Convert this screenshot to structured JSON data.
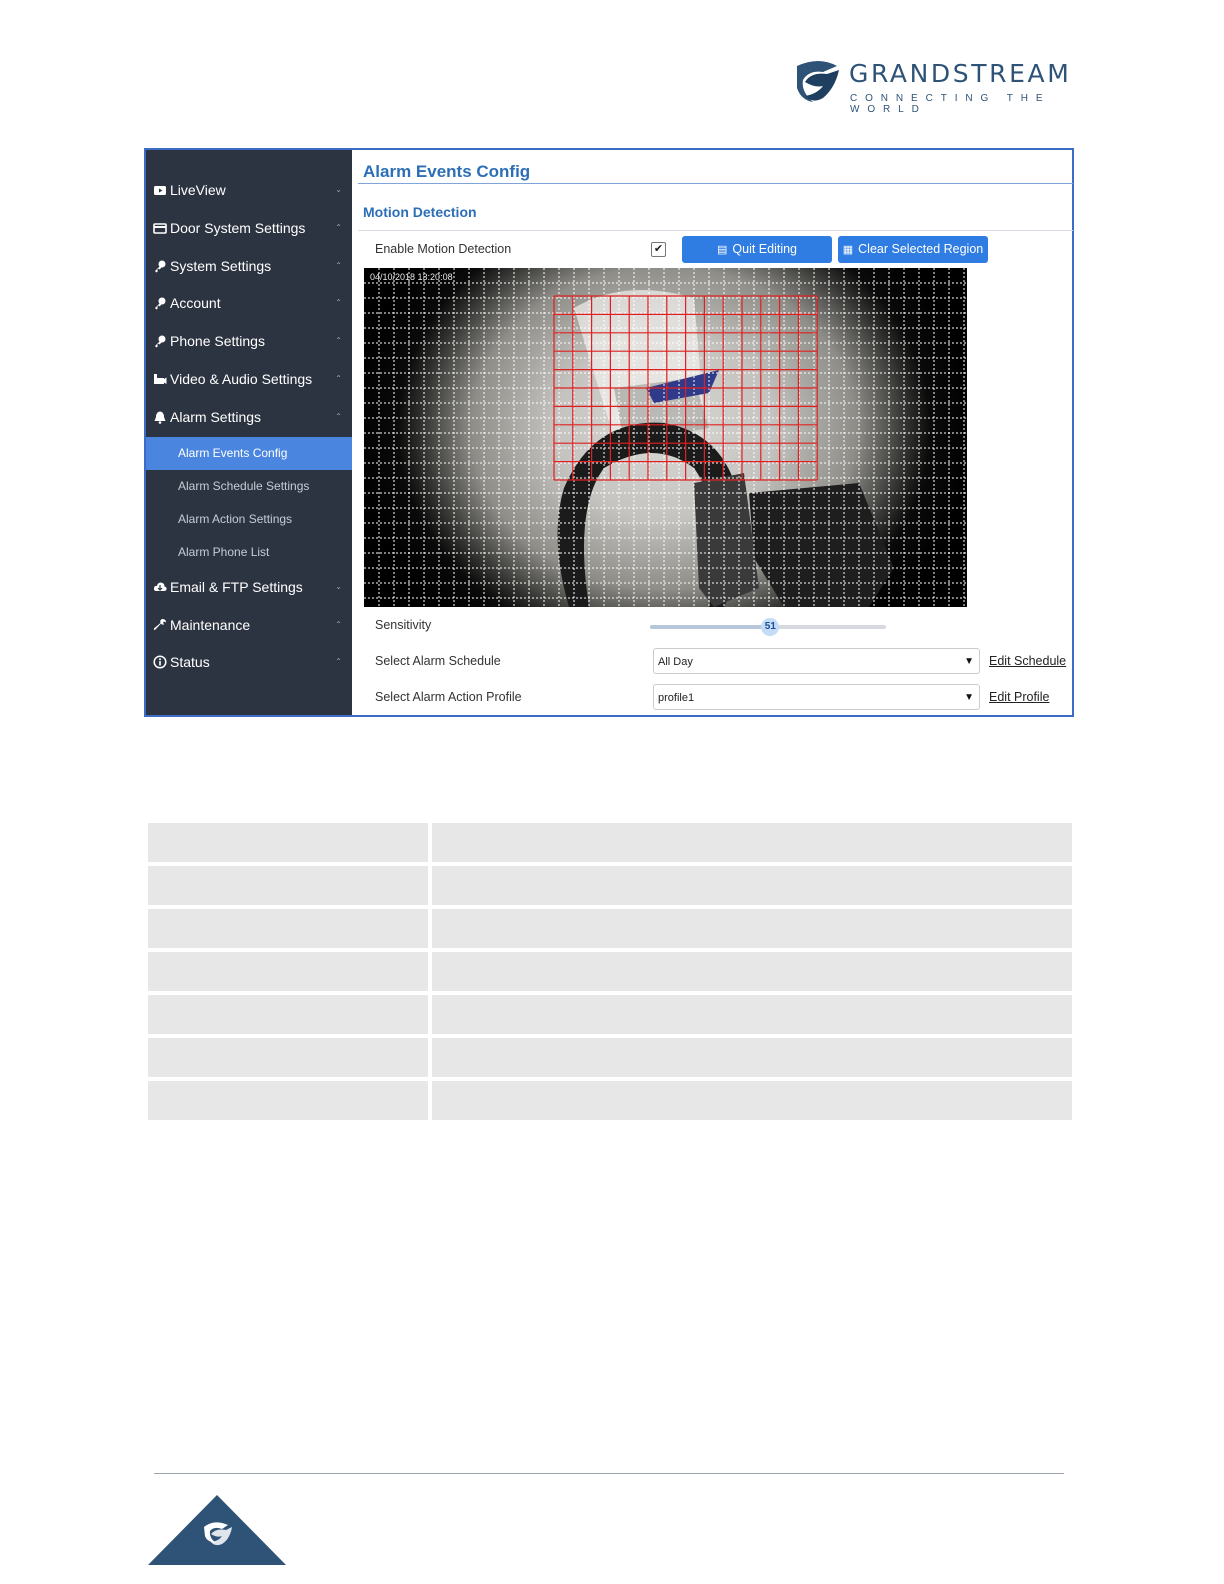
{
  "brand": {
    "name": "GRANDSTREAM",
    "tagline": "CONNECTING THE WORLD",
    "colors": {
      "navy": "#2e5377",
      "accent": "#2f7ce3",
      "sidebar": "#2d3441"
    }
  },
  "sidebar": {
    "items": [
      {
        "label": "LiveView",
        "icon": "video-icon",
        "chevron": "⌄"
      },
      {
        "label": "Door System Settings",
        "icon": "card-icon",
        "chevron": "⌃"
      },
      {
        "label": "System Settings",
        "icon": "key-icon",
        "chevron": "⌃"
      },
      {
        "label": "Account",
        "icon": "key-icon",
        "chevron": "⌃"
      },
      {
        "label": "Phone Settings",
        "icon": "key-icon",
        "chevron": "⌃"
      },
      {
        "label": "Video & Audio Settings",
        "icon": "camera-icon",
        "chevron": "⌃"
      },
      {
        "label": "Alarm Settings",
        "icon": "bell-icon",
        "chevron": "⌃"
      }
    ],
    "subitems": [
      {
        "label": "Alarm Events Config",
        "active": true
      },
      {
        "label": "Alarm Schedule Settings",
        "active": false
      },
      {
        "label": "Alarm Action Settings",
        "active": false
      },
      {
        "label": "Alarm Phone List",
        "active": false
      }
    ],
    "items_after": [
      {
        "label": "Email & FTP Settings",
        "icon": "cloud-icon",
        "chevron": "⌄"
      },
      {
        "label": "Maintenance",
        "icon": "wrench-icon",
        "chevron": "⌃"
      },
      {
        "label": "Status",
        "icon": "info-icon",
        "chevron": "⌃"
      }
    ]
  },
  "main": {
    "title": "Alarm Events Config",
    "section": "Motion Detection",
    "enable_label": "Enable Motion Detection",
    "enable_checked": true,
    "checkmark": "✔",
    "quit_button": "Quit Editing",
    "clear_button": "Clear Selected Region",
    "video_timestamp": "04/10/2018 13:20:08",
    "sensitivity_label": "Sensitivity",
    "sensitivity_value": 51,
    "sensitivity_max": 100,
    "schedule_label": "Select Alarm Schedule",
    "schedule_value": "All Day",
    "schedule_link": "Edit Schedule",
    "profile_label": "Select Alarm Action Profile",
    "profile_value": "profile1",
    "profile_link": "Edit Profile",
    "dropdown_arrow": "▼"
  },
  "table": {
    "row_count": 7
  }
}
